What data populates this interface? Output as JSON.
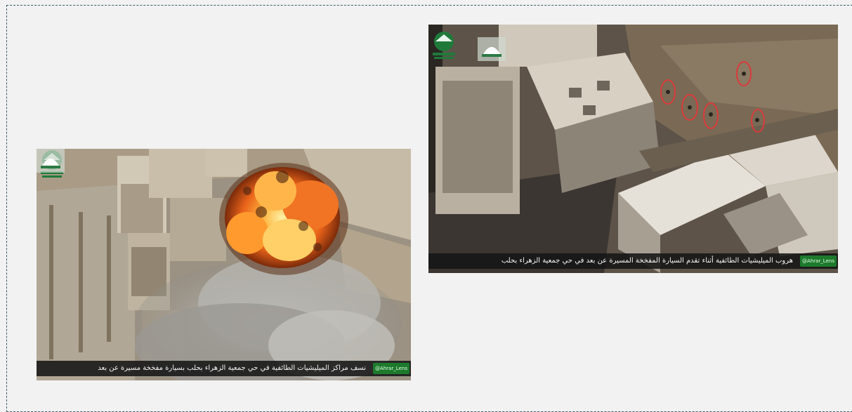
{
  "images": {
    "left": {
      "caption": "نسف مراكز الميليشيات الطائفية في حي جمعية الزهراء بحلب بسيارة مفخخة مسيرة عن بعد",
      "handle": "@Ahrar_Lens",
      "subject": "aerial view of an explosion fireball over damaged buildings"
    },
    "right": {
      "caption": "هروب الميليشيات الطائفية أثناء تقدم السيارة المفخخة المسيرة عن بعد في حي جمعية الزهراء بحلب",
      "handle": "@Ahrar_Lens",
      "subject": "aerial view of damaged buildings with red circles marking fleeing fighters"
    }
  },
  "colors": {
    "background": "#f2f2f2",
    "frame_border": "#3d5a66",
    "badge_green": "#1d7a2c",
    "circle_red": "#d93a3a"
  }
}
